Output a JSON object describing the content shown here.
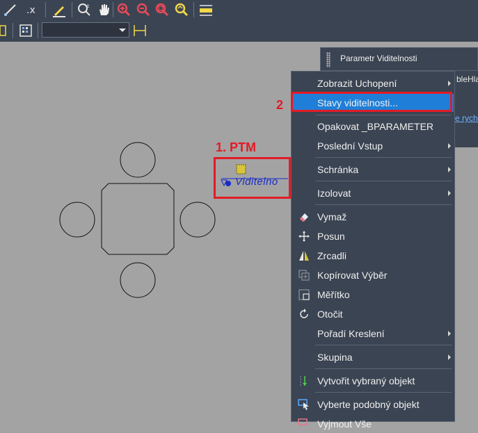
{
  "toolbar": {
    "icons": [
      "line-icon",
      "erase-icon",
      "match-icon",
      "zoom-realtime-icon",
      "pan-icon",
      "zoom-in-icon",
      "zoom-out-icon",
      "zoom-window-icon",
      "zoom-extents-icon",
      "measure-icon"
    ]
  },
  "palette": {
    "title": "Parametr Viditelnosti",
    "partial_text": "bleHla",
    "partial_link": "e rychl"
  },
  "annotations": {
    "step1": "1. PTM",
    "step2": "2"
  },
  "drawing": {
    "block_text": "Viditelno"
  },
  "context_menu": {
    "items": [
      {
        "label": "Zobrazit Uchopení",
        "submenu": true
      },
      {
        "label": "Stavy viditelnosti...",
        "submenu": false,
        "highlighted": true
      },
      {
        "label": "Opakovat _BPARAMETER",
        "submenu": false
      },
      {
        "label": "Poslední Vstup",
        "submenu": true
      },
      {
        "label": "Schránka",
        "submenu": true
      },
      {
        "label": "Izolovat",
        "submenu": true
      },
      {
        "label": "Vymaž",
        "submenu": false,
        "icon": "eraser-icon"
      },
      {
        "label": "Posun",
        "submenu": false,
        "icon": "move-icon"
      },
      {
        "label": "Zrcadli",
        "submenu": false,
        "icon": "mirror-icon"
      },
      {
        "label": "Kopírovat Výběr",
        "submenu": false,
        "icon": "copy-icon"
      },
      {
        "label": "Měřítko",
        "submenu": false,
        "icon": "scale-icon"
      },
      {
        "label": "Otočit",
        "submenu": false,
        "icon": "rotate-icon"
      },
      {
        "label": "Pořadí Kreslení",
        "submenu": true
      },
      {
        "label": "Skupina",
        "submenu": true
      },
      {
        "label": "Vytvořit vybraný objekt",
        "submenu": false,
        "icon": "add-selected-icon"
      },
      {
        "label": "Vyberte podobný objekt",
        "submenu": false,
        "icon": "select-similar-icon"
      },
      {
        "label": "Vyjmout Vše",
        "submenu": false,
        "icon": "deselect-icon"
      }
    ]
  },
  "colors": {
    "accent": "#1f7fd8",
    "annotation_red": "#e21b26",
    "ui_dark": "#3b4452",
    "canvas": "#a3a3a3"
  }
}
